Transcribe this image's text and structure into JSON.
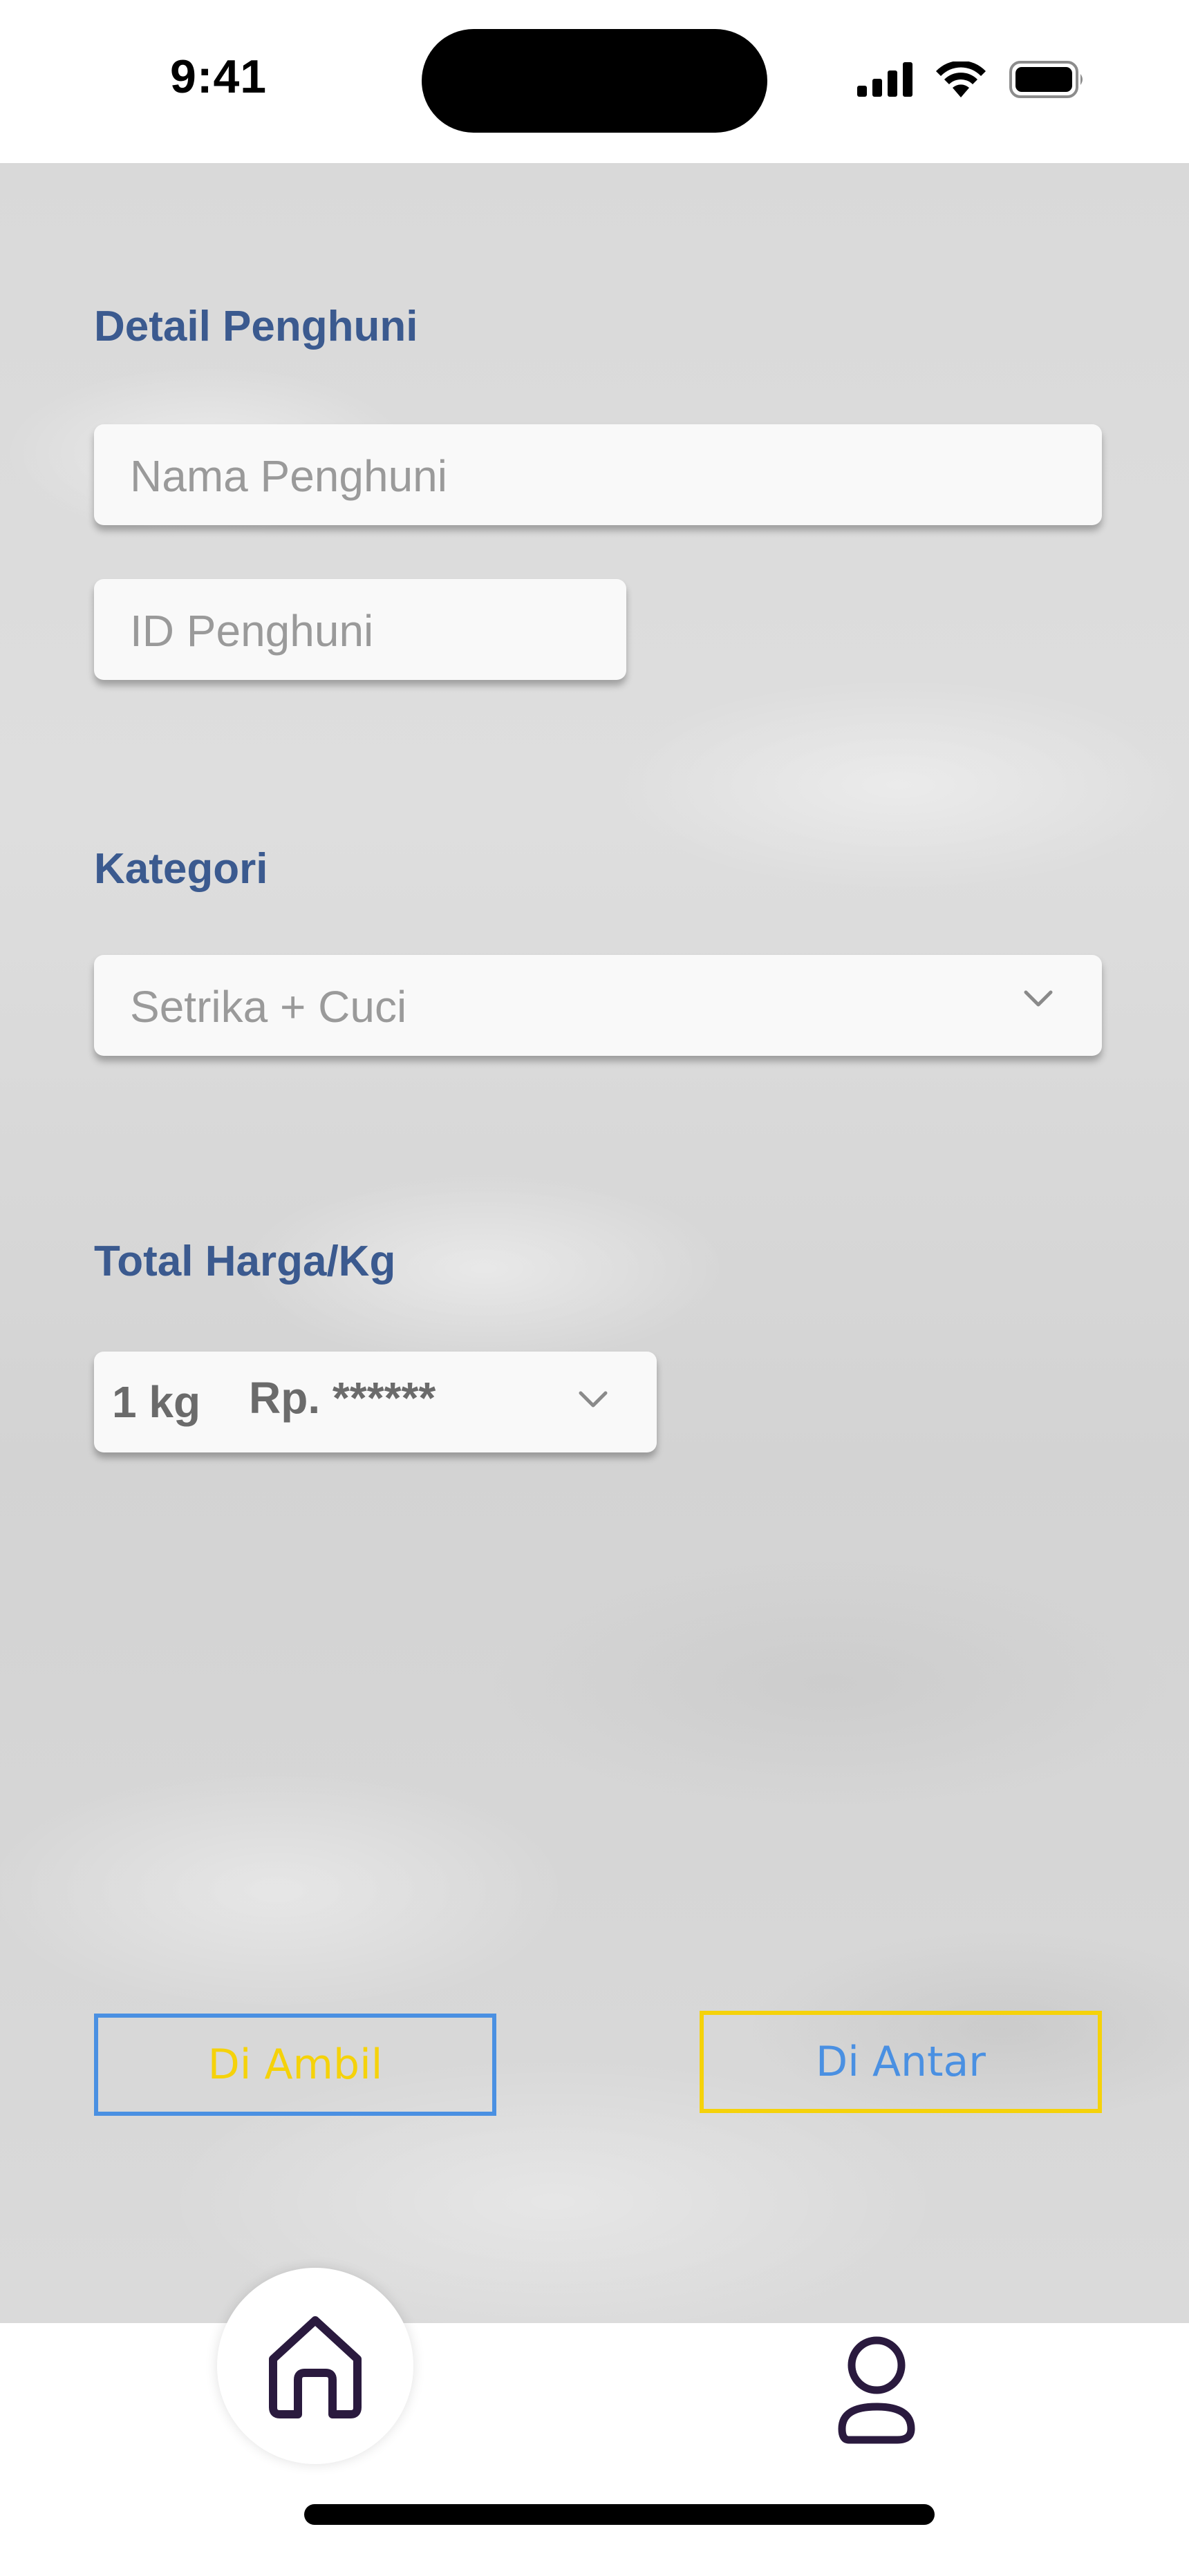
{
  "status_bar": {
    "time": "9:41"
  },
  "resident_details": {
    "section_title": "Detail Penghuni",
    "name_placeholder": "Nama Penghuni",
    "id_placeholder": "ID Penghuni"
  },
  "category": {
    "section_title": "Kategori",
    "selected": "Setrika + Cuci"
  },
  "price": {
    "section_title": "Total Harga/Kg",
    "quantity": "1 kg",
    "value": "Rp. ******"
  },
  "actions": {
    "pickup_label": "Di Ambil",
    "delivery_label": "Di Antar"
  },
  "colors": {
    "label_blue": "#3b5a8f",
    "accent_blue": "#4a90e2",
    "accent_yellow": "#f5d20a",
    "icon_dark": "#2a1a3e"
  },
  "bottom_nav": {
    "items": [
      {
        "icon": "home-icon",
        "active": true
      },
      {
        "icon": "user-icon",
        "active": false
      }
    ]
  }
}
